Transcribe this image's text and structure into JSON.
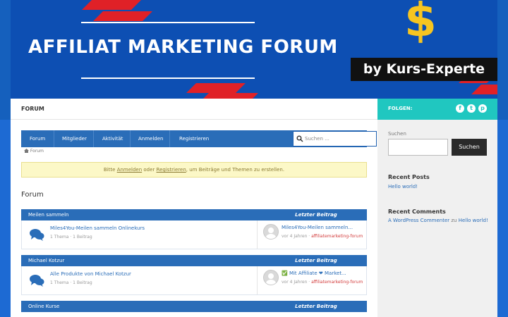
{
  "banner": {
    "title": "AFFILIAT MARKETING FORUM",
    "byline": "by Kurs-Experte",
    "dollar": "$"
  },
  "header": {
    "title": "FORUM"
  },
  "nav": {
    "items": [
      {
        "label": "Forum"
      },
      {
        "label": "Mitglieder"
      },
      {
        "label": "Aktivität"
      },
      {
        "label": "Anmelden"
      },
      {
        "label": "Registrieren"
      }
    ],
    "search_placeholder": "Suchen ..."
  },
  "breadcrumb": {
    "home": "Forum"
  },
  "notice": {
    "prefix": "Bitte ",
    "login": "Anmelden",
    "mid": " oder ",
    "register": "Registrieren",
    "suffix": ", um Beiträge und Themen zu erstellen."
  },
  "forum_heading": "Forum",
  "last_post_label": "Letzter Beitrag",
  "categories": [
    {
      "name": "Meilen sammeln",
      "forum_title": "Miles4You-Meilen sammeln Onlinekurs",
      "forum_meta": "1 Thema · 1 Beitrag",
      "last_title": "Miles4You-Meilen sammeln...",
      "last_meta": "vor 4 Jahren · ",
      "last_author": "affiliatemarketing-forum"
    },
    {
      "name": "Michael Kotzur",
      "forum_title": "Alle Produkte von Michael Kotzur",
      "forum_meta": "1 Thema · 1 Beitrag",
      "last_title": "✅ Mit Affiliate ❤ Market...",
      "last_meta": "vor 4 Jahren · ",
      "last_author": "affiliatemarketing-forum"
    },
    {
      "name": "Online Kurse"
    }
  ],
  "sidebar": {
    "follow_label": "FOLGEN:",
    "social": [
      "f",
      "t",
      "p"
    ],
    "search_label": "Suchen",
    "search_button": "Suchen",
    "recent_posts_title": "Recent Posts",
    "recent_posts": [
      "Hello world!"
    ],
    "recent_comments_title": "Recent Comments",
    "recent_comments_author": "A WordPress Commenter",
    "recent_comments_on": " zu ",
    "recent_comments_post": "Hello world!"
  },
  "colors": {
    "brand_blue": "#2a6db8",
    "banner_blue": "#0d4fb3",
    "accent_red": "#e02127",
    "dollar_gold": "#f7c520",
    "teal": "#20c7c0",
    "notice_bg": "#fcf8c7"
  }
}
